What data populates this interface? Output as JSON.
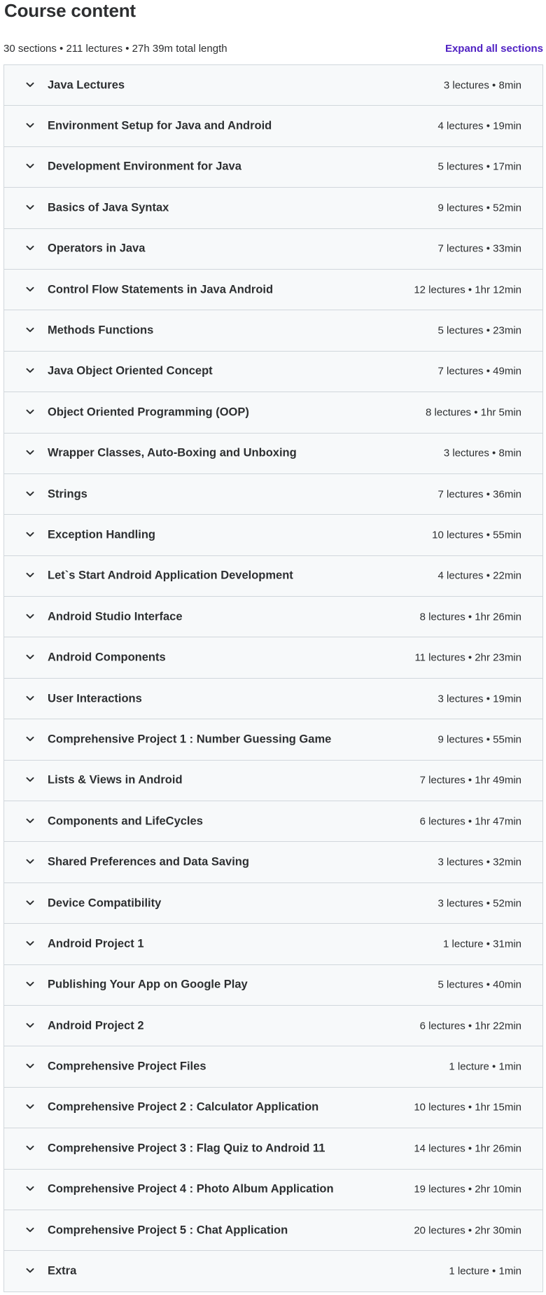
{
  "header": {
    "title": "Course content",
    "summary": "30 sections • 211 lectures • 27h 39m total length",
    "expand_all": "Expand all sections"
  },
  "sections": [
    {
      "title": "Java Lectures",
      "meta": "3 lectures • 8min"
    },
    {
      "title": "Environment Setup for Java and Android",
      "meta": "4 lectures • 19min"
    },
    {
      "title": "Development Environment for Java",
      "meta": "5 lectures • 17min"
    },
    {
      "title": "Basics of Java Syntax",
      "meta": "9 lectures • 52min"
    },
    {
      "title": "Operators in Java",
      "meta": "7 lectures • 33min"
    },
    {
      "title": "Control Flow Statements in Java Android",
      "meta": "12 lectures • 1hr 12min"
    },
    {
      "title": "Methods Functions",
      "meta": "5 lectures • 23min"
    },
    {
      "title": "Java Object Oriented Concept",
      "meta": "7 lectures • 49min"
    },
    {
      "title": "Object Oriented Programming (OOP)",
      "meta": "8 lectures • 1hr 5min"
    },
    {
      "title": "Wrapper Classes, Auto-Boxing and Unboxing",
      "meta": "3 lectures • 8min"
    },
    {
      "title": "Strings",
      "meta": "7 lectures • 36min"
    },
    {
      "title": "Exception Handling",
      "meta": "10 lectures • 55min"
    },
    {
      "title": "Let`s Start Android Application Development",
      "meta": "4 lectures • 22min"
    },
    {
      "title": "Android Studio Interface",
      "meta": "8 lectures • 1hr 26min"
    },
    {
      "title": "Android Components",
      "meta": "11 lectures • 2hr 23min"
    },
    {
      "title": "User Interactions",
      "meta": "3 lectures • 19min"
    },
    {
      "title": "Comprehensive Project 1 : Number Guessing Game",
      "meta": "9 lectures • 55min"
    },
    {
      "title": "Lists & Views in Android",
      "meta": "7 lectures • 1hr 49min"
    },
    {
      "title": "Components and LifeCycles",
      "meta": "6 lectures • 1hr 47min"
    },
    {
      "title": "Shared Preferences and Data Saving",
      "meta": "3 lectures • 32min"
    },
    {
      "title": "Device Compatibility",
      "meta": "3 lectures • 52min"
    },
    {
      "title": "Android Project 1",
      "meta": "1 lecture • 31min"
    },
    {
      "title": "Publishing Your App on Google Play",
      "meta": "5 lectures • 40min"
    },
    {
      "title": "Android Project 2",
      "meta": "6 lectures • 1hr 22min"
    },
    {
      "title": "Comprehensive Project Files",
      "meta": "1 lecture • 1min"
    },
    {
      "title": "Comprehensive Project 2 : Calculator Application",
      "meta": "10 lectures • 1hr 15min"
    },
    {
      "title": "Comprehensive Project 3 : Flag Quiz to Android 11",
      "meta": "14 lectures • 1hr 26min"
    },
    {
      "title": "Comprehensive Project 4 : Photo Album Application",
      "meta": "19 lectures • 2hr 10min"
    },
    {
      "title": "Comprehensive Project 5 : Chat Application",
      "meta": "20 lectures • 2hr 30min"
    },
    {
      "title": "Extra",
      "meta": "1 lecture • 1min"
    }
  ],
  "icons": {
    "section_toggle": "chevron-down-icon"
  },
  "colors": {
    "link": "#5022c3",
    "section_bg": "#f7f9fa",
    "border": "#d1d7dc",
    "text": "#2d2f31"
  }
}
